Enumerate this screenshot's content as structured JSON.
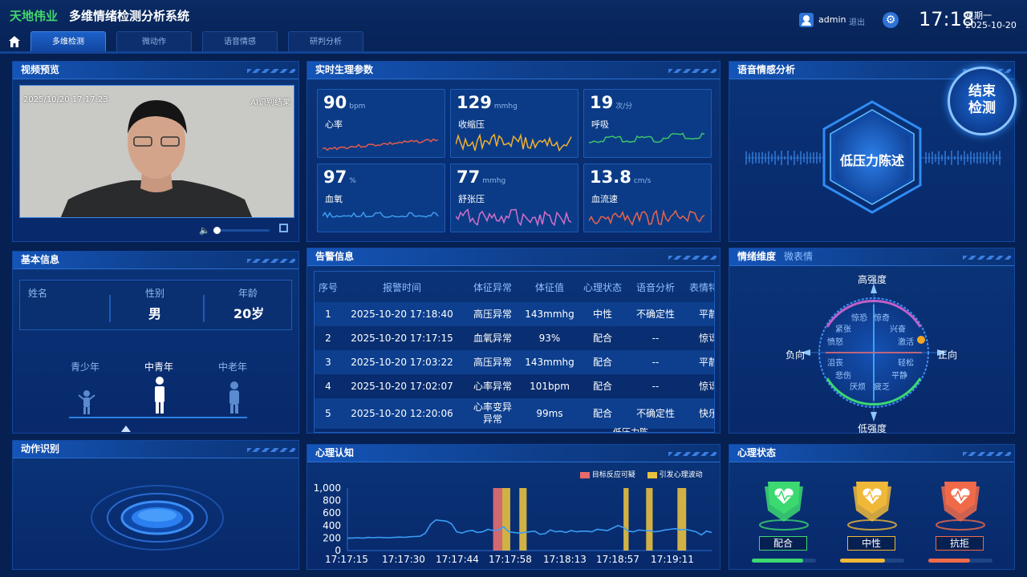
{
  "app": {
    "brand": "天地伟业",
    "title": "多维情绪检测分析系统"
  },
  "tabs": [
    {
      "label": "多维检测"
    },
    {
      "label": "微动作"
    },
    {
      "label": "语音情感"
    },
    {
      "label": "研判分析"
    }
  ],
  "user": {
    "name": "admin",
    "logout": "退出"
  },
  "clock": {
    "time": "17:18",
    "weekday": "星期一",
    "date": "2025-10-20"
  },
  "video": {
    "title": "视频预览",
    "timestamp": "2025/10/20 17:17:23",
    "label": "AI识别结果",
    "volume_fraction": 0.05
  },
  "vitals": {
    "title": "实时生理参数",
    "items": [
      {
        "value": "90",
        "unit": "bpm",
        "label": "心率",
        "color": "#e45a4e"
      },
      {
        "value": "129",
        "unit": "mmhg",
        "label": "收缩压",
        "color": "#f0b030"
      },
      {
        "value": "19",
        "unit": "次/分",
        "label": "呼吸",
        "color": "#3cc36a"
      },
      {
        "value": "97",
        "unit": "%",
        "label": "血氧",
        "color": "#3d9af0"
      },
      {
        "value": "77",
        "unit": "mmhg",
        "label": "舒张压",
        "color": "#d070c8"
      },
      {
        "value": "13.8",
        "unit": "cm/s",
        "label": "血流速",
        "color": "#e8644e"
      }
    ]
  },
  "voice": {
    "title": "语音情感分析",
    "result": "低压力陈述",
    "end_button": "结束\n检测"
  },
  "basic": {
    "title": "基本信息",
    "name_label": "姓名",
    "gender_label": "性别",
    "gender": "男",
    "age_label": "年龄",
    "age": "20岁",
    "age_groups": [
      "青少年",
      "中青年",
      "中老年"
    ]
  },
  "alarms": {
    "title": "告警信息",
    "headers": [
      "序号",
      "报警时间",
      "体征异常",
      "体征值",
      "心理状态",
      "语音分析",
      "表情特征"
    ],
    "rows": [
      [
        "1",
        "2025-10-20 17:18:40",
        "高压异常",
        "143mmhg",
        "中性",
        "不确定性",
        "平静"
      ],
      [
        "2",
        "2025-10-20 17:17:15",
        "血氧异常",
        "93%",
        "配合",
        "--",
        "惊讶"
      ],
      [
        "3",
        "2025-10-20 17:03:22",
        "高压异常",
        "143mmhg",
        "配合",
        "--",
        "平静"
      ],
      [
        "4",
        "2025-10-20 17:02:07",
        "心率异常",
        "101bpm",
        "配合",
        "--",
        "惊讶"
      ],
      [
        "5",
        "2025-10-20 12:20:06",
        "心率变异\n异常",
        "99ms",
        "配合",
        "不确定性",
        "快乐"
      ]
    ],
    "partial": "低压力陈"
  },
  "emotion": {
    "title": "情绪维度",
    "subtitle": "微表情",
    "top": "高强度",
    "bottom": "低强度",
    "left": "负向",
    "right": "正向",
    "words": [
      "惊恐",
      "惊奇",
      "紧张",
      "兴奋",
      "愤怒",
      "激活",
      "沮丧",
      "轻松",
      "悲伤",
      "平静",
      "厌烦",
      "疲乏"
    ]
  },
  "action": {
    "title": "动作识别"
  },
  "cognition": {
    "title": "心理认知",
    "legend": [
      {
        "name": "目标反应可疑",
        "color": "#e86a6a"
      },
      {
        "name": "引发心理波动",
        "color": "#e8c040"
      }
    ]
  },
  "chart_data": {
    "type": "line",
    "title": "",
    "x_ticks": [
      "17:17:15",
      "17:17:30",
      "17:17:44",
      "17:17:58",
      "17:18:13",
      "17:18:57",
      "17:19:11"
    ],
    "y_ticks": [
      "1,000",
      "800",
      "600",
      "400",
      "200",
      "0"
    ],
    "ylim": [
      0,
      1000
    ],
    "series": [
      {
        "values": [
          200,
          200,
          205,
          198,
          210,
          205,
          212,
          208,
          205,
          210,
          215,
          212,
          220,
          225,
          230,
          280,
          420,
          490,
          480,
          470,
          430,
          300,
          280,
          310,
          320,
          290,
          300,
          340,
          320,
          330,
          380,
          300,
          290,
          280,
          290,
          300,
          310,
          260,
          270,
          330,
          300,
          310,
          290,
          320,
          300,
          310,
          310,
          300,
          340,
          330,
          320,
          360,
          400,
          370,
          310,
          300,
          330,
          320,
          320,
          300,
          310,
          330,
          340,
          350,
          330,
          340,
          320,
          300,
          250,
          310,
          290
        ]
      }
    ],
    "bands": [
      {
        "start": 0.4,
        "end": 0.425,
        "kind": "suspicious"
      },
      {
        "start": 0.425,
        "end": 0.447,
        "kind": "fluctuation"
      },
      {
        "start": 0.472,
        "end": 0.492,
        "kind": "fluctuation"
      },
      {
        "start": 0.758,
        "end": 0.772,
        "kind": "fluctuation"
      },
      {
        "start": 0.82,
        "end": 0.838,
        "kind": "fluctuation"
      },
      {
        "start": 0.906,
        "end": 0.93,
        "kind": "fluctuation"
      }
    ]
  },
  "psych": {
    "title": "心理状态",
    "states": [
      {
        "label": "配合",
        "color": "#3cd870",
        "fill": 0.8
      },
      {
        "label": "中性",
        "color": "#f0b838",
        "fill": 0.7
      },
      {
        "label": "抗拒",
        "color": "#f06a4a",
        "fill": 0.65
      }
    ]
  }
}
